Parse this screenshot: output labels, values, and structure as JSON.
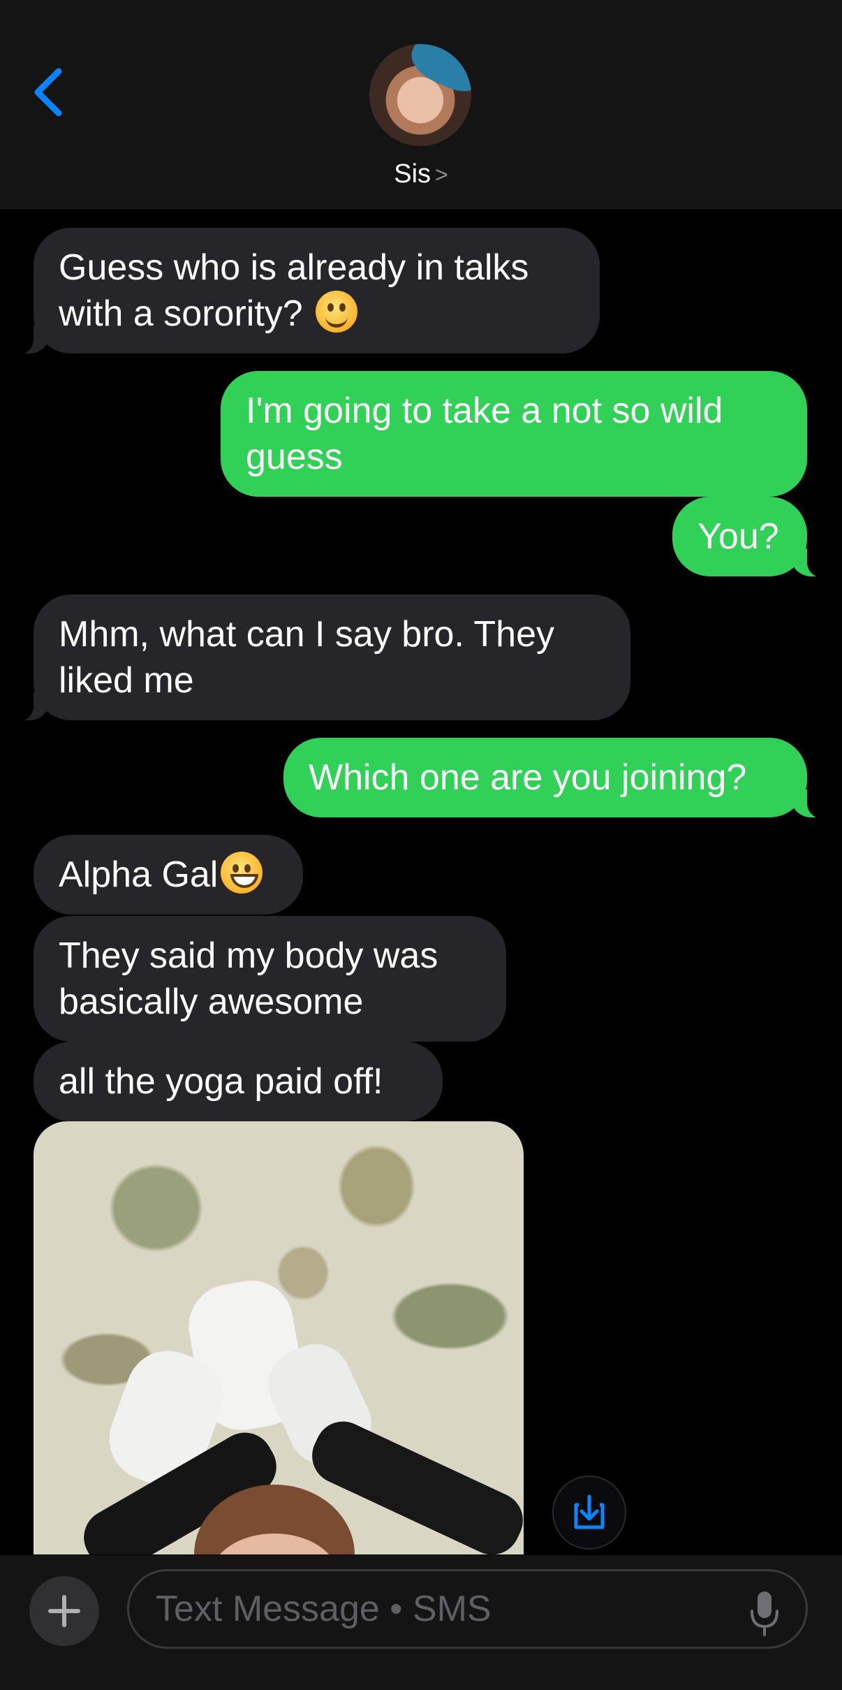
{
  "header": {
    "contact_name": "Sis",
    "chevron": ">"
  },
  "messages": [
    {
      "direction": "incoming",
      "text": "Guess who is already in talks with a sorority?",
      "emoji": "smiling-face-icon"
    },
    {
      "direction": "outgoing",
      "text": "I'm going to take a not so wild guess"
    },
    {
      "direction": "outgoing",
      "text": "You?"
    },
    {
      "direction": "incoming",
      "text": "Mhm, what can I say bro. They liked me"
    },
    {
      "direction": "outgoing",
      "text": "Which one are you joining?"
    },
    {
      "direction": "incoming",
      "text": "Alpha Gal",
      "emoji": "grinning-face-icon"
    },
    {
      "direction": "incoming",
      "text": "They said my body was basically awesome"
    },
    {
      "direction": "incoming",
      "text": "all the yoga paid off!"
    },
    {
      "direction": "incoming",
      "type": "photo"
    }
  ],
  "composer": {
    "placeholder": "Text Message • SMS"
  },
  "colors": {
    "outgoing_bubble": "#31d158",
    "incoming_bubble": "#26252a",
    "accent": "#0a84ff",
    "background": "#000000"
  }
}
